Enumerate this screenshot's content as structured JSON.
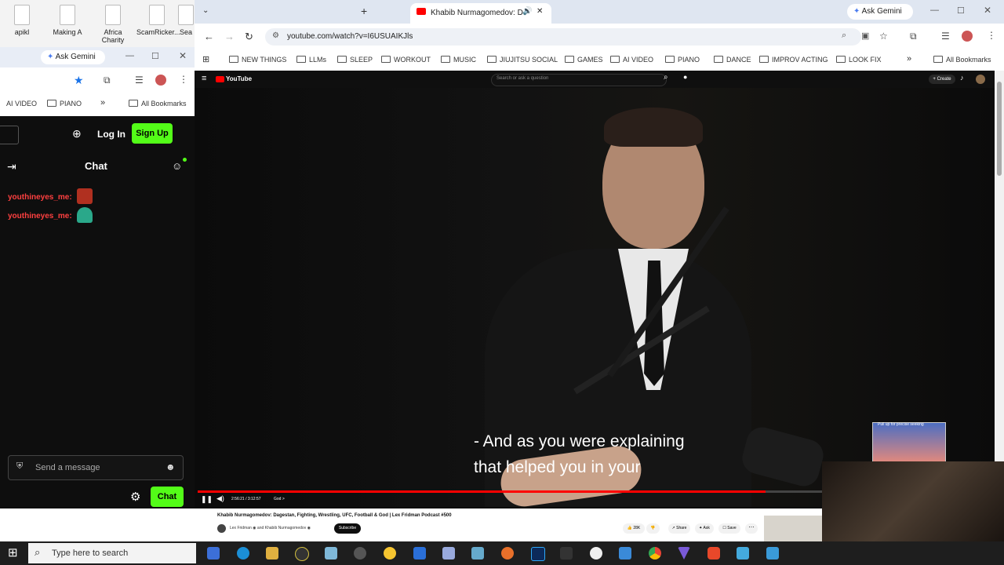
{
  "desktop": {
    "icons": [
      "apikl",
      "Making A",
      "Africa Charity",
      "ScamRicker...",
      "Sea"
    ]
  },
  "left_window": {
    "gemini_label": "Ask Gemini",
    "bookmarks": [
      "AI VIDEO",
      "PIANO"
    ],
    "all_bookmarks": "All Bookmarks",
    "login_label": "Log In",
    "signup_label": "Sign Up",
    "chat_title": "Chat",
    "messages": [
      {
        "user": "youthineyes_me"
      },
      {
        "user": "youthineyes_me"
      }
    ],
    "message_placeholder": "Send a message",
    "chat_button": "Chat"
  },
  "browser": {
    "tab_title": "Khabib Nurmagomedov: D",
    "gemini_label": "Ask Gemini",
    "url": "youtube.com/watch?v=I6USUAIKJls",
    "bookmarks": [
      "NEW THINGS",
      "LLMs",
      "SLEEP",
      "WORKOUT",
      "MUSIC",
      "JIUJITSU SOCIAL",
      "GAMES",
      "AI VIDEO",
      "PIANO",
      "DANCE",
      "IMPROV ACTING",
      "LOOK FIX"
    ],
    "all_bookmarks": "All Bookmarks"
  },
  "youtube": {
    "logo": "YouTube",
    "search_placeholder": "Search or ask a question",
    "create_label": "+ Create",
    "caption_line1": "- And as you were explaining",
    "caption_line2": "that helped you in your",
    "time": "2:56:21 / 3:12:57",
    "chapter": "God >",
    "progress": 0.91,
    "pullup_label": "Pull up for precise seeking",
    "video_title": "Khabib Nurmagomedov: Dagestan, Fighting, Wrestling, UFC, Football & God | Lex Fridman Podcast #500",
    "channel": "Lex Fridman ◉ and Khabib Nurmagomedov ◉",
    "subscribe_label": "Subscribe",
    "likes": "28K",
    "share_label": "Share",
    "ask_label": "Ask",
    "save_label": "Save"
  },
  "taskbar": {
    "search_placeholder": "Type here to search"
  },
  "colors": {
    "accent_green": "#53fc18",
    "yt_red": "#ff0000",
    "username_red": "#ff4040"
  }
}
